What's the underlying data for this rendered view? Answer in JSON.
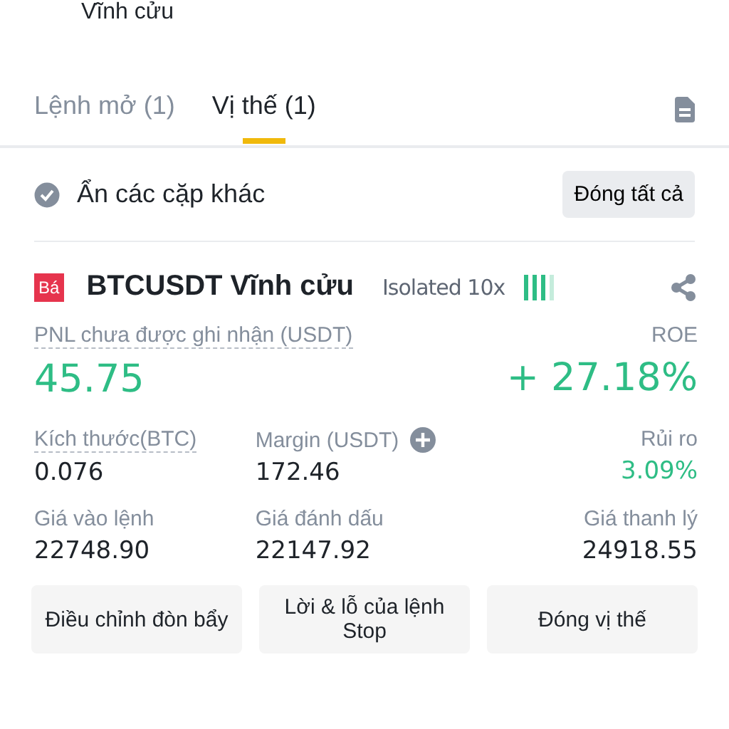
{
  "header": {
    "subtitle": "Vĩnh cửu"
  },
  "tabs": [
    {
      "label": "Lệnh mở (1)",
      "selected": false
    },
    {
      "label": "Vị thế (1)",
      "selected": true
    }
  ],
  "filter": {
    "label": "Ẩn các cặp khác",
    "checked": true,
    "button": "Đóng tất cả"
  },
  "position": {
    "side_badge": "Bá",
    "symbol": "BTCUSDT Vĩnh cửu",
    "margin_mode": "Isolated 10x",
    "pnl": {
      "label": "PNL chưa được ghi nhận (USDT)",
      "value": "45.75"
    },
    "roe": {
      "label": "ROE",
      "value": "+ 27.18%"
    },
    "stats": [
      {
        "label": "Kích thước(BTC)",
        "value": "0.076",
        "positive": false,
        "dotted": true,
        "add_button": false
      },
      {
        "label": "Margin (USDT)",
        "value": "172.46",
        "positive": false,
        "dotted": false,
        "add_button": true
      },
      {
        "label": "Rủi ro",
        "value": "3.09%",
        "positive": true,
        "dotted": false,
        "add_button": false
      },
      {
        "label": "Giá vào lệnh",
        "value": "22748.90",
        "positive": false,
        "dotted": false,
        "add_button": false
      },
      {
        "label": "Giá đánh dấu",
        "value": "22147.92",
        "positive": false,
        "dotted": false,
        "add_button": false
      },
      {
        "label": "Giá thanh lý",
        "value": "24918.55",
        "positive": false,
        "dotted": false,
        "add_button": false
      }
    ],
    "actions": [
      "Điều chỉnh đòn bẩy",
      "Lời & lỗ của lệnh Stop",
      "Đóng vị thế"
    ]
  }
}
